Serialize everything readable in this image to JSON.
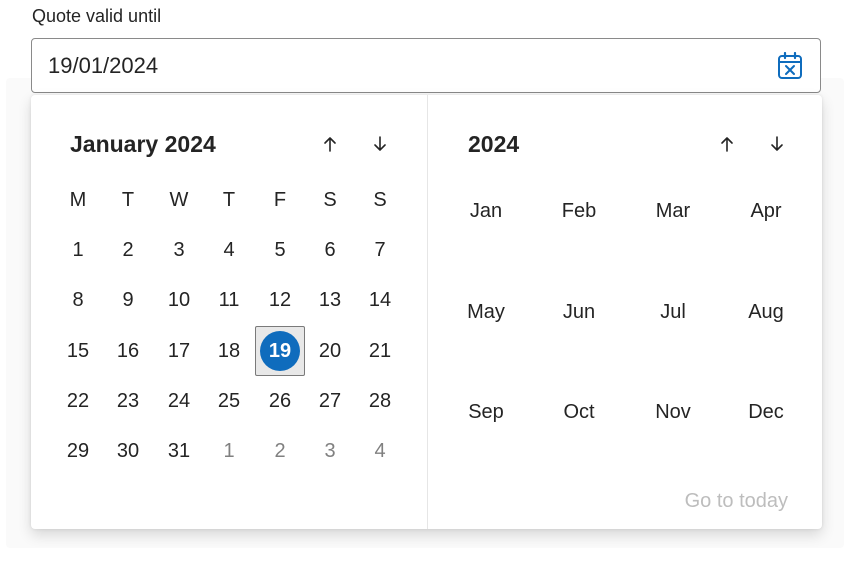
{
  "field": {
    "label": "Quote valid until",
    "value": "19/01/2024",
    "calendar_icon": "calendar-dismiss-icon",
    "accent": "#0f6cbd"
  },
  "day_picker": {
    "header": "January 2024",
    "prev_icon": "arrow-up-icon",
    "next_icon": "arrow-down-icon",
    "weekdays": [
      "M",
      "T",
      "W",
      "T",
      "F",
      "S",
      "S"
    ],
    "weeks": [
      [
        "1",
        "2",
        "3",
        "4",
        "5",
        "6",
        "7"
      ],
      [
        "8",
        "9",
        "10",
        "11",
        "12",
        "13",
        "14"
      ],
      [
        "15",
        "16",
        "17",
        "18",
        "19",
        "20",
        "21"
      ],
      [
        "22",
        "23",
        "24",
        "25",
        "26",
        "27",
        "28"
      ],
      [
        "29",
        "30",
        "31",
        "1",
        "2",
        "3",
        "4"
      ]
    ],
    "selected_day": "19"
  },
  "month_picker": {
    "header": "2024",
    "prev_icon": "arrow-up-icon",
    "next_icon": "arrow-down-icon",
    "months": [
      "Jan",
      "Feb",
      "Mar",
      "Apr",
      "May",
      "Jun",
      "Jul",
      "Aug",
      "Sep",
      "Oct",
      "Nov",
      "Dec"
    ]
  },
  "go_to_today": "Go to today"
}
